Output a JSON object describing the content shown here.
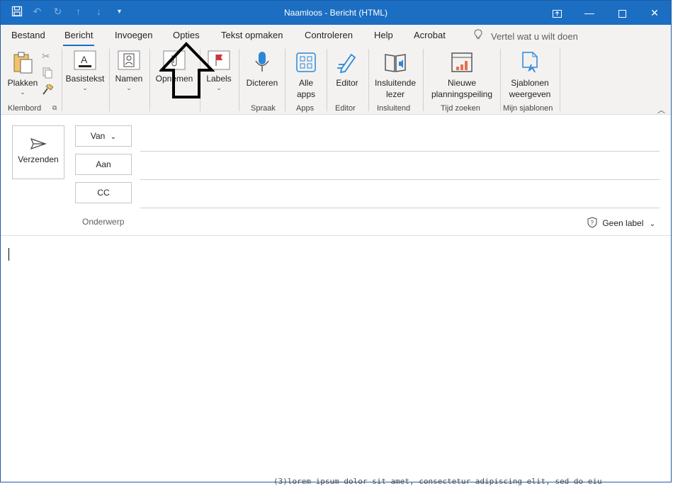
{
  "window": {
    "title": "Naamloos  -  Bericht (HTML)"
  },
  "tabs": [
    {
      "label": "Bestand"
    },
    {
      "label": "Bericht"
    },
    {
      "label": "Invoegen"
    },
    {
      "label": "Opties"
    },
    {
      "label": "Tekst opmaken"
    },
    {
      "label": "Controleren"
    },
    {
      "label": "Help"
    },
    {
      "label": "Acrobat"
    }
  ],
  "tell_me": "Vertel wat u wilt doen",
  "ribbon": {
    "plakken": "Plakken",
    "klembord": "Klembord",
    "basistekst": "Basistekst",
    "namen": "Namen",
    "opnemen": "Opnemen",
    "labels": "Labels",
    "dicteren": "Dicteren",
    "spraak": "Spraak",
    "alle_apps": [
      "Alle",
      "apps"
    ],
    "apps": "Apps",
    "editor_btn": "Editor",
    "editor_group": "Editor",
    "insluitende": [
      "Insluitende",
      "lezer"
    ],
    "insluitend": "Insluitend",
    "planning": [
      "Nieuwe",
      "planningspeiling"
    ],
    "tijd_zoeken": "Tijd zoeken",
    "sjablonen": [
      "Sjablonen",
      "weergeven"
    ],
    "mijn_sjablonen": "Mijn sjablonen"
  },
  "compose": {
    "send": "Verzenden",
    "from": "Van",
    "to": "Aan",
    "cc": "CC",
    "subject_placeholder": "Onderwerp",
    "sensitivity": "Geen label"
  },
  "background_text": "(3)lorem ipsum dolor sit amet, consectetur adipiscing elit, sed do eiu"
}
